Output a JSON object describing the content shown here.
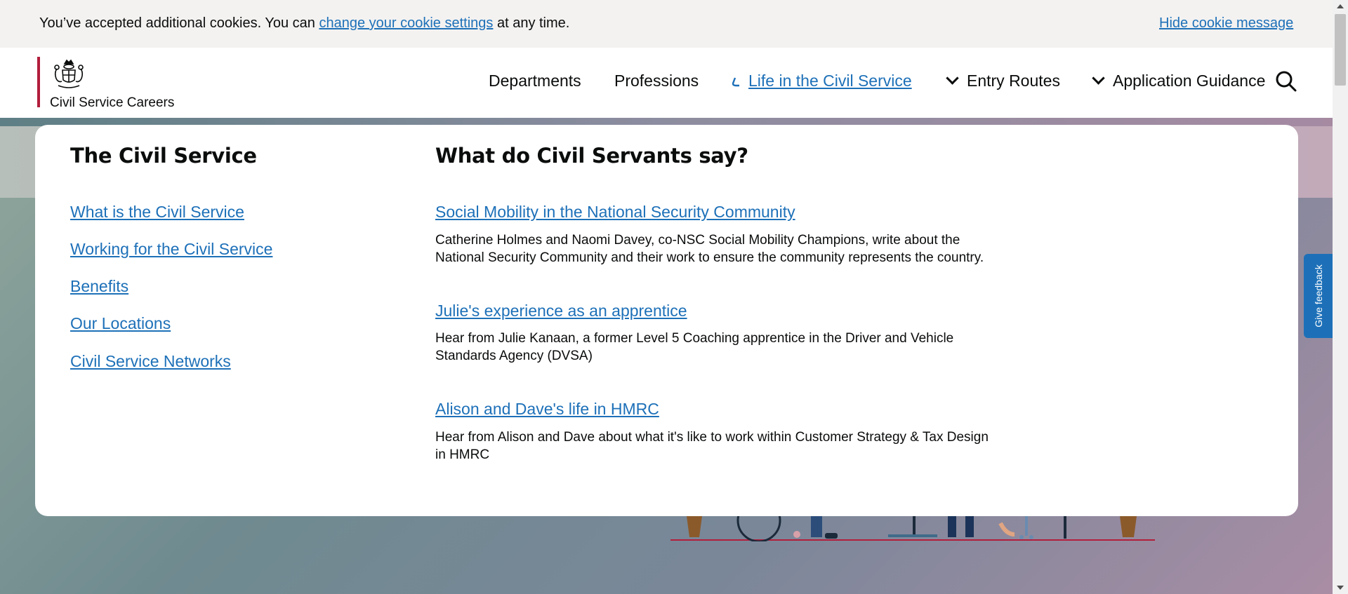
{
  "cookie_banner": {
    "text_before": "You’ve accepted additional cookies. You can ",
    "link": "change your cookie settings",
    "text_after": " at any time.",
    "hide_link": "Hide cookie message"
  },
  "header": {
    "brand_name": "Civil Service Careers",
    "nav": [
      {
        "label": "Departments"
      },
      {
        "label": "Professions"
      },
      {
        "label": "Life in the Civil Service",
        "active": true
      },
      {
        "label": "Entry Routes"
      },
      {
        "label": "Application Guidance"
      }
    ]
  },
  "menu": {
    "left_heading": "The Civil Service",
    "left_links": [
      "What is the Civil Service",
      "Working for the Civil Service",
      "Benefits",
      "Our Locations",
      "Civil Service Networks"
    ],
    "right_heading": "What do Civil Servants say?",
    "articles": [
      {
        "title": "Social Mobility in the National Security Community",
        "desc_line1": "Catherine Holmes and Naomi Davey, co-NSC Social Mobility Champions, write about the",
        "desc_line2": "National Security Community and their work to ensure the community represents the country."
      },
      {
        "title": "Julie's experience as an apprentice",
        "desc_line1": "Hear from Julie Kanaan, a former Level 5 Coaching apprentice in the Driver and Vehicle",
        "desc_line2": "Standards Agency (DVSA)"
      },
      {
        "title": "Alison and Dave's life in HMRC",
        "desc_line1": "Hear from Alison and Dave about what it's like to work within Customer Strategy & Tax Design",
        "desc_line2": "in HMRC"
      }
    ]
  },
  "feedback": {
    "label": "Give feedback"
  },
  "colors": {
    "link": "#1d70b8",
    "brand_red": "#b21e3c",
    "feedback_bg": "#1d70b8"
  }
}
